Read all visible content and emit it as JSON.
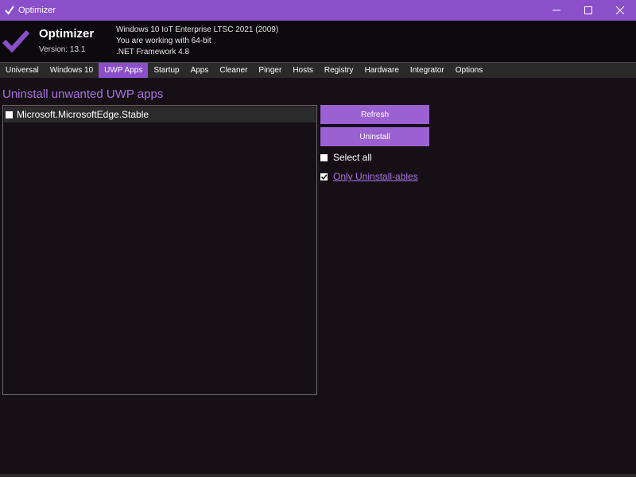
{
  "window": {
    "title": "Optimizer",
    "accent": "#8a4fc9",
    "controls": [
      "minimize-icon",
      "maximize-icon",
      "close-icon"
    ]
  },
  "header": {
    "app_name": "Optimizer",
    "version": "Version: 13.1",
    "os_info": "Windows 10 IoT Enterprise LTSC 2021 (2009)",
    "arch_info": "You are working with 64-bit",
    "framework": ".NET Framework 4.8",
    "logo_icon": "checkmark-icon"
  },
  "tabs": [
    {
      "label": "Universal"
    },
    {
      "label": "Windows 10"
    },
    {
      "label": "UWP Apps",
      "active": true
    },
    {
      "label": "Startup"
    },
    {
      "label": "Apps"
    },
    {
      "label": "Cleaner"
    },
    {
      "label": "Pinger"
    },
    {
      "label": "Hosts"
    },
    {
      "label": "Registry"
    },
    {
      "label": "Hardware"
    },
    {
      "label": "Integrator"
    },
    {
      "label": "Options"
    }
  ],
  "main": {
    "section_title": "Uninstall unwanted UWP apps",
    "apps": [
      {
        "name": "Microsoft.MicrosoftEdge.Stable",
        "checked": false
      }
    ],
    "refresh_label": "Refresh",
    "uninstall_label": "Uninstall",
    "select_all_label": "Select all",
    "select_all_checked": false,
    "only_uninstallables_label": "Only Uninstall-ables",
    "only_uninstallables_checked": true
  }
}
